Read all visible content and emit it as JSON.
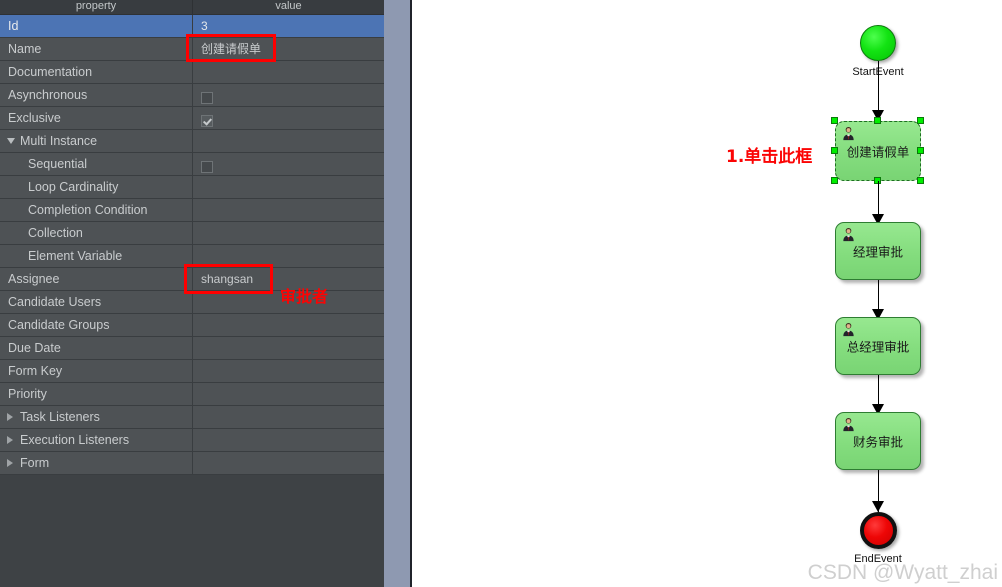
{
  "panel": {
    "columns": {
      "property": "property",
      "value": "value"
    },
    "rows": [
      {
        "label": "Id",
        "value": "3",
        "type": "text",
        "indent": 0,
        "toggle": "",
        "selected": true
      },
      {
        "label": "Name",
        "value": "创建请假单",
        "type": "text",
        "indent": 0,
        "toggle": "",
        "selected": false
      },
      {
        "label": "Documentation",
        "value": "",
        "type": "text",
        "indent": 0,
        "toggle": "",
        "selected": false
      },
      {
        "label": "Asynchronous",
        "value": "",
        "type": "checkbox-off",
        "indent": 0,
        "toggle": "",
        "selected": false
      },
      {
        "label": "Exclusive",
        "value": "",
        "type": "checkbox-on",
        "indent": 0,
        "toggle": "",
        "selected": false
      },
      {
        "label": "Multi Instance",
        "value": "",
        "type": "text",
        "indent": 0,
        "toggle": "down",
        "selected": false
      },
      {
        "label": "Sequential",
        "value": "",
        "type": "checkbox-off",
        "indent": 1,
        "toggle": "",
        "selected": false
      },
      {
        "label": "Loop Cardinality",
        "value": "",
        "type": "text",
        "indent": 1,
        "toggle": "",
        "selected": false
      },
      {
        "label": "Completion Condition",
        "value": "",
        "type": "text",
        "indent": 1,
        "toggle": "",
        "selected": false
      },
      {
        "label": "Collection",
        "value": "",
        "type": "text",
        "indent": 1,
        "toggle": "",
        "selected": false
      },
      {
        "label": "Element Variable",
        "value": "",
        "type": "text",
        "indent": 1,
        "toggle": "",
        "selected": false
      },
      {
        "label": "Assignee",
        "value": "shangsan",
        "type": "text",
        "indent": 0,
        "toggle": "",
        "selected": false
      },
      {
        "label": "Candidate Users",
        "value": "",
        "type": "text",
        "indent": 0,
        "toggle": "",
        "selected": false
      },
      {
        "label": "Candidate Groups",
        "value": "",
        "type": "text",
        "indent": 0,
        "toggle": "",
        "selected": false
      },
      {
        "label": "Due Date",
        "value": "",
        "type": "text",
        "indent": 0,
        "toggle": "",
        "selected": false
      },
      {
        "label": "Form Key",
        "value": "",
        "type": "text",
        "indent": 0,
        "toggle": "",
        "selected": false
      },
      {
        "label": "Priority",
        "value": "",
        "type": "text",
        "indent": 0,
        "toggle": "",
        "selected": false
      },
      {
        "label": "Task Listeners",
        "value": "",
        "type": "text",
        "indent": 0,
        "toggle": "right",
        "selected": false
      },
      {
        "label": "Execution Listeners",
        "value": "",
        "type": "text",
        "indent": 0,
        "toggle": "right",
        "selected": false
      },
      {
        "label": "Form",
        "value": "",
        "type": "text",
        "indent": 0,
        "toggle": "right",
        "selected": false
      }
    ]
  },
  "annotations": {
    "color": "#ff0000",
    "name_highlight_label": "",
    "assignee_note": "审批者",
    "click_note": "1.单击此框"
  },
  "diagram": {
    "start_event_label": "StartEvent",
    "end_event_label": "EndEvent",
    "tasks": [
      {
        "label": "创建请假单",
        "selected": true
      },
      {
        "label": "经理审批",
        "selected": false
      },
      {
        "label": "总经理审批",
        "selected": false
      },
      {
        "label": "财务审批",
        "selected": false
      }
    ]
  },
  "watermark": {
    "text": "CSDN @Wyatt_zhai"
  }
}
